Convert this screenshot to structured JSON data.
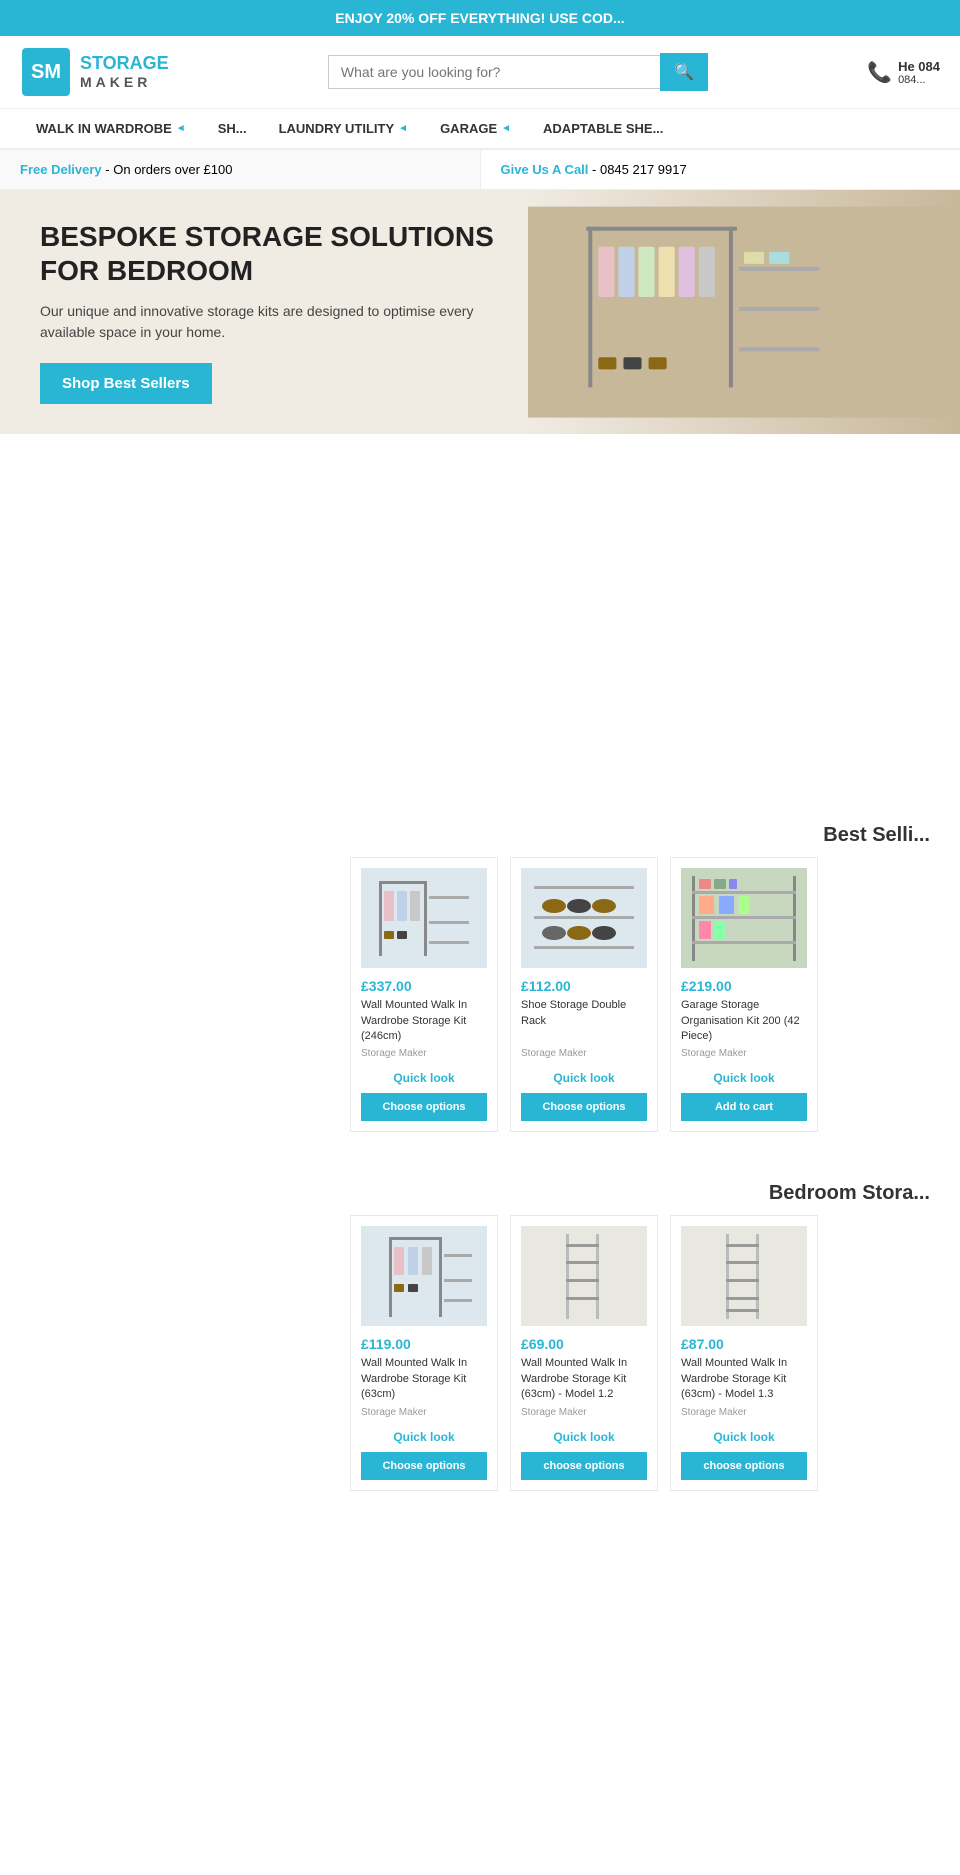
{
  "banner": {
    "text": "ENJOY 20% OFF EVERYTHING! USE COD..."
  },
  "header": {
    "logo_line1": "STORAGE",
    "logo_line2": "MAKER",
    "search_placeholder": "What are you looking for?",
    "search_btn_icon": "🔍",
    "phone_label": "He 084",
    "phone_number": "084..."
  },
  "nav": {
    "items": [
      {
        "label": "WALK IN WARDROBE",
        "has_chevron": true
      },
      {
        "label": "SH...",
        "has_chevron": false
      },
      {
        "label": "LAUNDRY UTILITY",
        "has_chevron": true
      },
      {
        "label": "GARAGE",
        "has_chevron": true
      },
      {
        "label": "ADAPTABLE SHE...",
        "has_chevron": false
      }
    ]
  },
  "info_bar": {
    "left_highlight": "Free Delivery",
    "left_text": " - On orders over £100",
    "right_highlight": "Give Us A Call",
    "right_text": " - 0845 217 9917"
  },
  "hero": {
    "title": "BESPOKE STORAGE SOLUTIONS FOR BEDROOM",
    "description": "Our unique and innovative storage kits are designed to optimise every available space in your home.",
    "button_label": "Shop Best Sellers"
  },
  "best_sellers": {
    "heading": "Best Selli...",
    "products": [
      {
        "price": "£337.00",
        "name": "Wall Mounted Walk In Wardrobe Storage Kit (246cm)",
        "brand": "Storage Maker",
        "quick_look": "Quick look",
        "action_label": "Choose options",
        "action_type": "choose"
      },
      {
        "price": "£112.00",
        "name": "Shoe Storage Double Rack",
        "brand": "Storage Maker",
        "quick_look": "Quick look",
        "action_label": "Choose options",
        "action_type": "choose"
      },
      {
        "price": "£219.00",
        "name": "Garage Storage Organisation Kit 200 (42 Piece)",
        "brand": "Storage Maker",
        "quick_look": "Quick look",
        "action_label": "Add to cart",
        "action_type": "addcart"
      }
    ]
  },
  "bedroom_storage": {
    "heading": "Bedroom Stora...",
    "products": [
      {
        "price": "£119.00",
        "name": "Wall Mounted Walk In Wardrobe Storage Kit (63cm)",
        "brand": "Storage Maker",
        "quick_look": "Quick look",
        "action_label": "Choose options",
        "action_type": "choose"
      },
      {
        "price": "£69.00",
        "name": "Wall Mounted Walk In Wardrobe Storage Kit (63cm) - Model 1.2",
        "brand": "Storage Maker",
        "quick_look": "Quick look",
        "action_label": "choose options",
        "action_type": "choose"
      },
      {
        "price": "£87.00",
        "name": "Wall Mounted Walk In Wardrobe Storage Kit (63cm) - Model 1.3",
        "brand": "Storage Maker",
        "quick_look": "Quick look",
        "action_label": "choose options",
        "action_type": "choose"
      }
    ]
  }
}
